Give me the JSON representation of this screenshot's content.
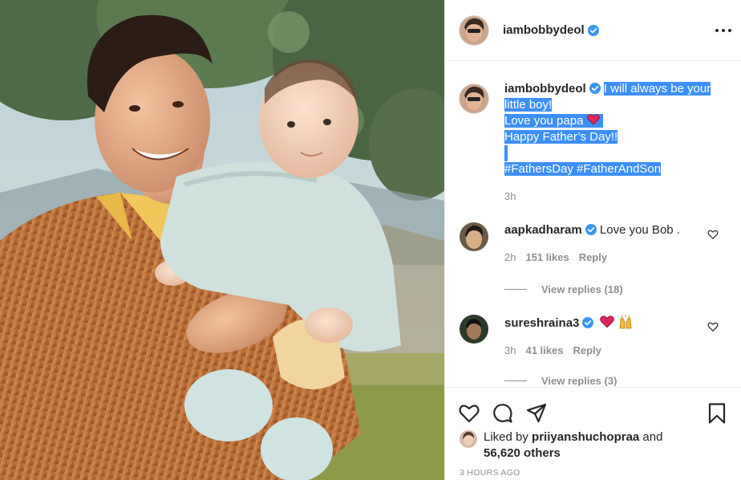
{
  "post": {
    "username": "iambobbydeol",
    "caption_lines": [
      "I will always be your",
      "little boy!",
      "Love you papa",
      "Happy Father’s Day!!",
      "",
      "#FathersDay #FatherAndSon"
    ],
    "caption_age": "3h"
  },
  "comments": [
    {
      "username": "aapkadharam",
      "text": "Love you Bob .",
      "age": "2h",
      "likes": "151 likes",
      "reply": "Reply",
      "view_replies": "View replies (18)"
    },
    {
      "username": "sureshraina3",
      "text": "",
      "age": "3h",
      "likes": "41 likes",
      "reply": "Reply",
      "view_replies": "View replies (3)"
    }
  ],
  "liked_by": {
    "prefix": "Liked by",
    "user": "priiyanshuchopraa",
    "and": "and",
    "count": "56,620 others"
  },
  "timestamp": "3 HOURS AGO",
  "colors": {
    "verified": "#3897f0",
    "highlight": "#3d8ff7",
    "heart_emoji": "#e0245e"
  },
  "icons": [
    "more-options-icon",
    "verified-icon",
    "like-icon",
    "comment-icon",
    "share-icon",
    "save-icon",
    "heart-emoji-icon",
    "praise-hands-emoji-icon"
  ]
}
